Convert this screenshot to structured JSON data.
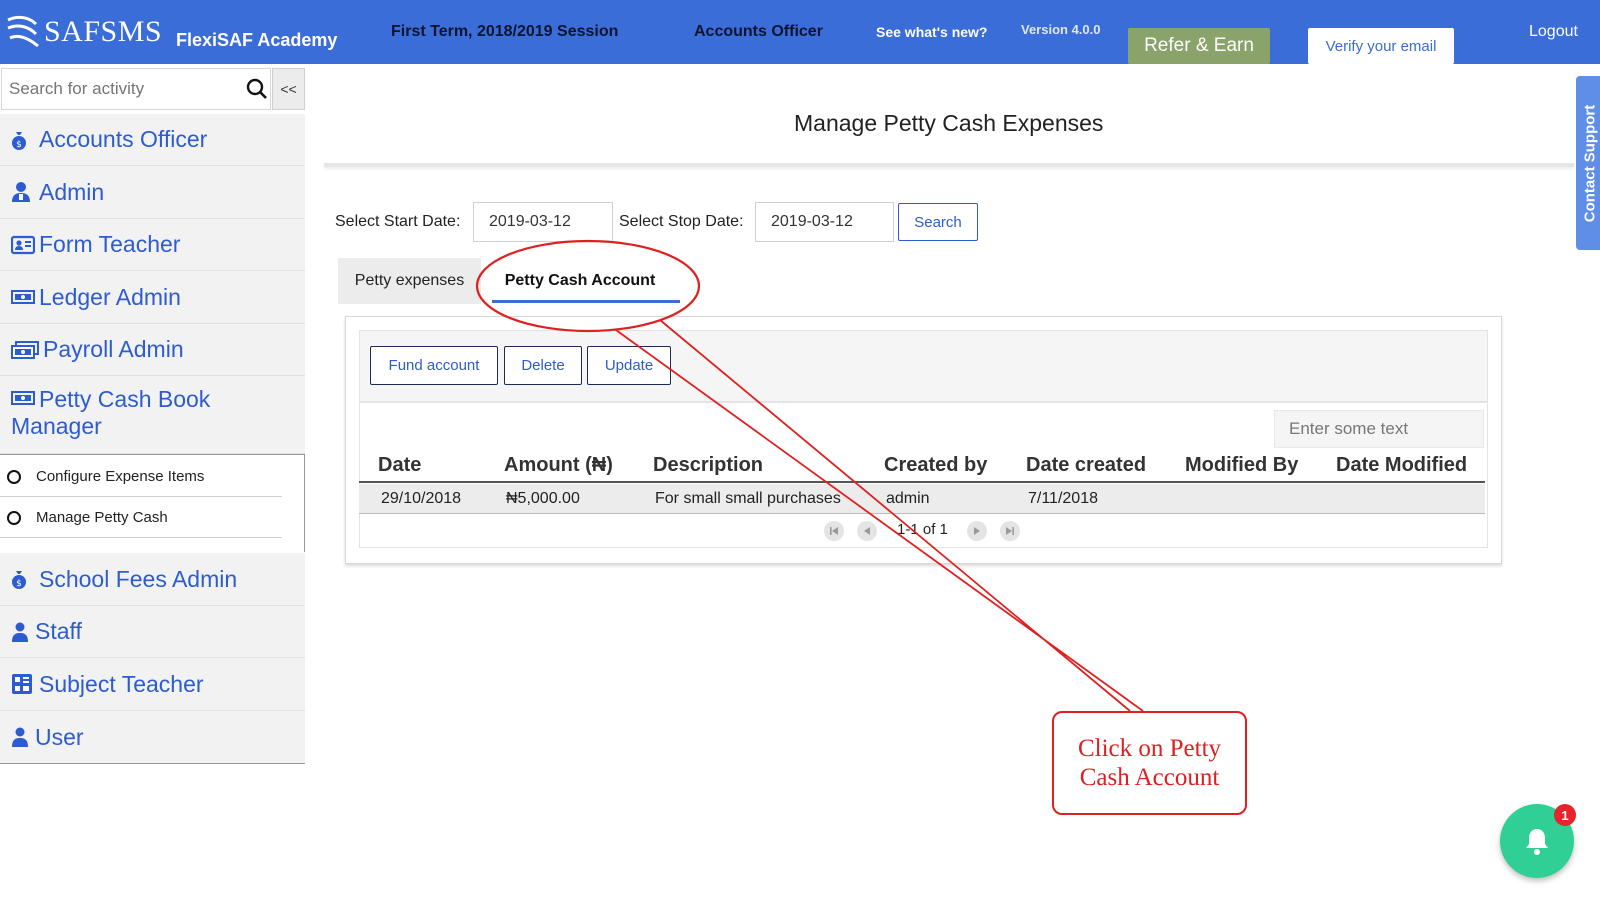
{
  "header": {
    "logo_text": "SAFSMS",
    "academy": "FlexiSAF Academy",
    "term": "First Term, 2018/2019 Session",
    "role": "Accounts Officer",
    "whats_new": "See what's new?",
    "version": "Version 4.0.0",
    "refer": "Refer & Earn",
    "verify": "Verify your email",
    "logout": "Logout"
  },
  "sidebar": {
    "search_placeholder": "Search for activity",
    "collapse": "<<",
    "items": [
      {
        "label": "Accounts Officer",
        "icon": "money-bag-icon"
      },
      {
        "label": "Admin",
        "icon": "admin-user-icon"
      },
      {
        "label": "Form Teacher",
        "icon": "id-card-icon"
      },
      {
        "label": "Ledger Admin",
        "icon": "banknote-icon"
      },
      {
        "label": "Payroll Admin",
        "icon": "banknotes-icon"
      },
      {
        "label": "Petty Cash Book Manager",
        "icon": "banknote-icon"
      },
      {
        "label": "School Fees Admin",
        "icon": "money-bag-icon"
      },
      {
        "label": "Staff",
        "icon": "user-icon"
      },
      {
        "label": "Subject Teacher",
        "icon": "calculator-icon"
      },
      {
        "label": "User",
        "icon": "user-icon"
      }
    ],
    "submenu": [
      {
        "label": "Configure Expense Items"
      },
      {
        "label": "Manage Petty Cash"
      }
    ]
  },
  "main": {
    "title": "Manage Petty Cash Expenses",
    "start_label": "Select Start Date:",
    "start_value": "2019-03-12",
    "stop_label": "Select Stop Date:",
    "stop_value": "2019-03-12",
    "search_button": "Search",
    "tabs": [
      {
        "label": "Petty expenses",
        "active": false
      },
      {
        "label": "Petty Cash Account",
        "active": true
      }
    ],
    "actions": {
      "fund": "Fund account",
      "delete": "Delete",
      "update": "Update"
    },
    "filter_placeholder": "Enter some text",
    "table": {
      "columns": [
        "Date",
        "Amount (₦)",
        "Description",
        "Created by",
        "Date created",
        "Modified By",
        "Date Modified"
      ],
      "rows": [
        [
          "29/10/2018",
          "₦5,000.00",
          "For small small purchases",
          "admin",
          "7/11/2018",
          "",
          ""
        ]
      ]
    },
    "pagination": "1-1 of 1"
  },
  "contact_support": "Contact Support",
  "callout": {
    "text": "Click on Petty Cash Account"
  },
  "notifications": {
    "count": "1"
  },
  "colors": {
    "topbar": "#3a6dd8",
    "link": "#2d5bd0",
    "refer_bg": "#8aa36a",
    "annotation": "#e02020",
    "bell": "#2fcf95"
  }
}
